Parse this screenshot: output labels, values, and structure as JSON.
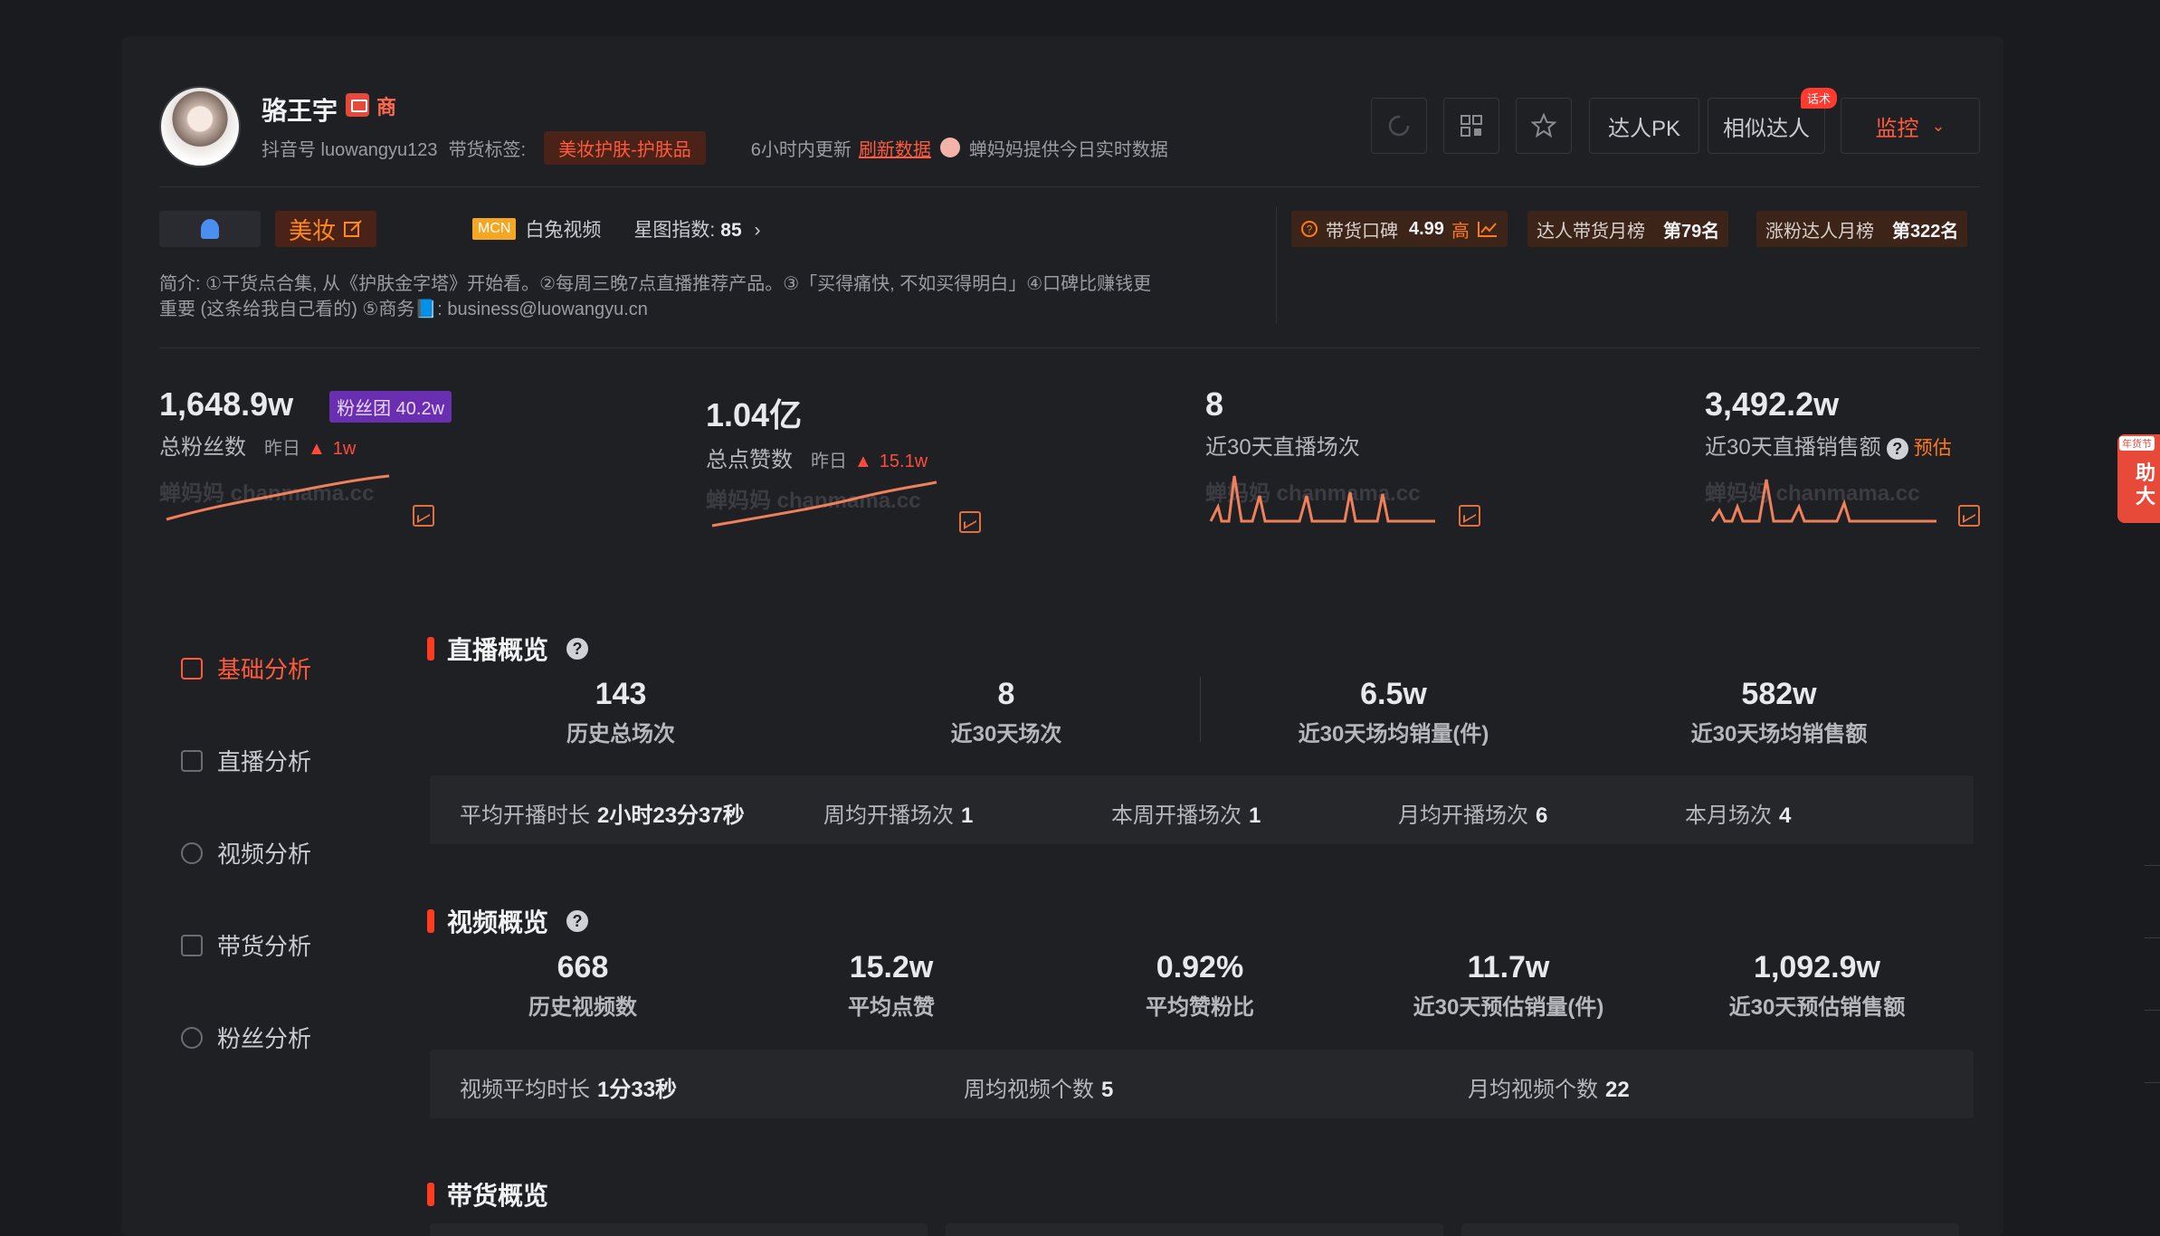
{
  "profile": {
    "name": "骆王宇",
    "shop_badge": "商",
    "douyin_id": "抖音号 luowangyu123",
    "tag_label": "带货标签:",
    "tag_value": "美妆护肤-护肤品",
    "update_text": "6小时内更新",
    "refresh_label": "刷新数据",
    "realtime_text": "蝉妈妈提供今日实时数据"
  },
  "toolbar": {
    "pk_label": "达人PK",
    "similar_label": "相似达人",
    "monitor_label": "监控",
    "hot_tag": "话术"
  },
  "tags": {
    "category": "美妆",
    "mcn_logo": "MCN",
    "mcn_name": "白兔视频",
    "star_index_label": "星图指数:",
    "star_index_value": "85",
    "reputation_label": "带货口碑",
    "reputation_value": "4.99",
    "reputation_level": "高",
    "sales_rank_label": "达人带货月榜",
    "sales_rank_value": "第79名",
    "fans_rank_label": "涨粉达人月榜",
    "fans_rank_value": "第322名"
  },
  "bio": {
    "line1": "简介: ①干货点合集, 从《护肤金字塔》开始看。②每周三晚7点直播推荐产品。③「买得痛快, 不如买得明白」④口碑比赚钱更",
    "line2": "重要 (这条给我自己看的) ⑤商务📘: business@luowangyu.cn"
  },
  "stats": {
    "fans": {
      "value": "1,648.9w",
      "label": "总粉丝数",
      "yesterday": "昨日",
      "delta": "1w",
      "club": "粉丝团 40.2w"
    },
    "likes": {
      "value": "1.04亿",
      "label": "总点赞数",
      "yesterday": "昨日",
      "delta": "15.1w"
    },
    "lives": {
      "value": "8",
      "label": "近30天直播场次"
    },
    "live_sales": {
      "value": "3,492.2w",
      "label": "近30天直播销售额",
      "est": "预估"
    },
    "watermark": "蝉妈妈 chanmama.cc"
  },
  "sidebar": {
    "items": [
      {
        "label": "基础分析",
        "icon": "bar-chart-icon"
      },
      {
        "label": "直播分析",
        "icon": "live-icon"
      },
      {
        "label": "视频分析",
        "icon": "play-icon"
      },
      {
        "label": "带货分析",
        "icon": "bag-icon"
      },
      {
        "label": "粉丝分析",
        "icon": "user-icon"
      }
    ]
  },
  "live_overview": {
    "title": "直播概览",
    "kpis": [
      {
        "value": "143",
        "label": "历史总场次"
      },
      {
        "value": "8",
        "label": "近30天场次"
      },
      {
        "value": "6.5w",
        "label": "近30天场均销量(件)"
      },
      {
        "value": "582w",
        "label": "近30天场均销售额"
      }
    ],
    "sub": [
      {
        "label": "平均开播时长",
        "value": "2小时23分37秒"
      },
      {
        "label": "周均开播场次",
        "value": "1"
      },
      {
        "label": "本周开播场次",
        "value": "1"
      },
      {
        "label": "月均开播场次",
        "value": "6"
      },
      {
        "label": "本月场次",
        "value": "4"
      }
    ]
  },
  "video_overview": {
    "title": "视频概览",
    "kpis": [
      {
        "value": "668",
        "label": "历史视频数"
      },
      {
        "value": "15.2w",
        "label": "平均点赞"
      },
      {
        "value": "0.92%",
        "label": "平均赞粉比"
      },
      {
        "value": "11.7w",
        "label": "近30天预估销量(件)"
      },
      {
        "value": "1,092.9w",
        "label": "近30天预估销售额"
      }
    ],
    "sub": [
      {
        "label": "视频平均时长",
        "value": "1分33秒"
      },
      {
        "label": "周均视频个数",
        "value": "5"
      },
      {
        "label": "月均视频个数",
        "value": "22"
      }
    ]
  },
  "goods_overview": {
    "title": "带货概览"
  },
  "float_helper": {
    "tag": "年货节",
    "text": "助大"
  },
  "colors": {
    "accent": "#ff5a3c",
    "bg": "#1a1b1e",
    "card": "#1f2024",
    "orange": "#ff7a1a"
  }
}
